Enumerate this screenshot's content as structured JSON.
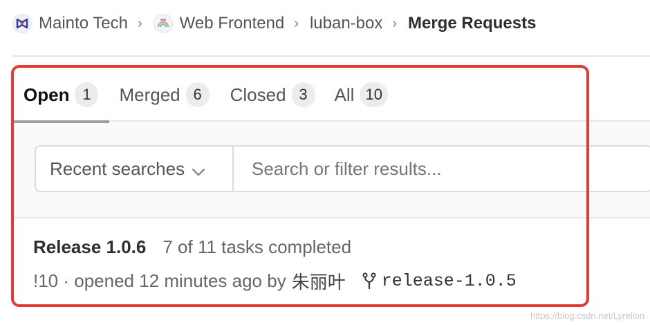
{
  "breadcrumb": {
    "items": [
      {
        "label": "Mainto Tech",
        "icon": "mainto-logo-icon"
      },
      {
        "label": "Web Frontend",
        "icon": "rainbow-group-icon"
      },
      {
        "label": "luban-box"
      }
    ],
    "current": "Merge Requests",
    "separator": "›"
  },
  "tabs": [
    {
      "label": "Open",
      "count": "1",
      "active": true
    },
    {
      "label": "Merged",
      "count": "6"
    },
    {
      "label": "Closed",
      "count": "3"
    },
    {
      "label": "All",
      "count": "10"
    }
  ],
  "filter": {
    "recent_label": "Recent searches",
    "search_placeholder": "Search or filter results..."
  },
  "merge_request": {
    "title": "Release 1.0.6",
    "tasks": "7 of 11 tasks completed",
    "meta": "!10 · opened 12 minutes ago by",
    "author": "朱丽叶",
    "branch": "release-1.0.5"
  },
  "watermark": "https://blog.csdn.net/Lyrelion",
  "colors": {
    "highlight": "#e53935",
    "active_tab_underline": "#9e9e9e",
    "count_badge_bg": "#ececec"
  }
}
